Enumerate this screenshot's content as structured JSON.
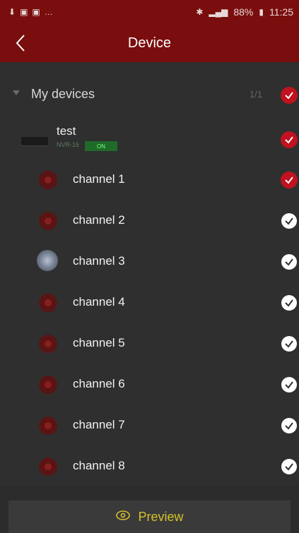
{
  "status_bar": {
    "battery": "88%",
    "time": "11:25"
  },
  "app_bar": {
    "title": "Device"
  },
  "group": {
    "label": "My devices",
    "count": "1/1"
  },
  "device": {
    "name": "test",
    "model": "NVR-16",
    "status": "ON"
  },
  "channels": [
    {
      "label": "channel 1",
      "selected": true
    },
    {
      "label": "channel 2",
      "selected": false
    },
    {
      "label": "channel 3",
      "selected": false
    },
    {
      "label": "channel 4",
      "selected": false
    },
    {
      "label": "channel 5",
      "selected": false
    },
    {
      "label": "channel 6",
      "selected": false
    },
    {
      "label": "channel 7",
      "selected": false
    },
    {
      "label": "channel 8",
      "selected": false
    }
  ],
  "preview": {
    "label": "Preview"
  },
  "colors": {
    "app_bar": "#7a0d0d",
    "check_red": "#c1121f",
    "preview_text": "#d6c12b"
  }
}
